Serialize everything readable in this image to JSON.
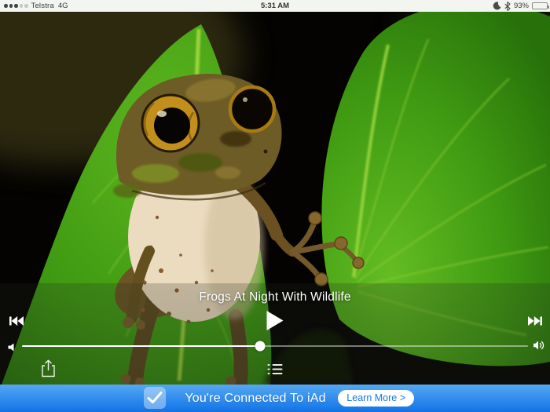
{
  "status_bar": {
    "carrier": "Telstra",
    "network": "4G",
    "time": "5:31 AM",
    "battery_percent": "93%",
    "signal_filled_dots": 3,
    "signal_total_dots": 5,
    "icons": [
      "cell-signal-dots",
      "do-not-disturb-moon",
      "bluetooth",
      "battery"
    ]
  },
  "player": {
    "title": "Frogs At Night With Wildlife",
    "volume_percent": 47,
    "transport_icons": [
      "previous-track",
      "play",
      "next-track"
    ],
    "secondary_icons": [
      "share",
      "playlist"
    ],
    "photo_subject": "frog on green leaves"
  },
  "banner": {
    "message": "You're Connected To iAd",
    "cta_label": "Learn More >",
    "checkbox_icon": "checkmark",
    "colors": {
      "top": "#54a8f3",
      "bottom": "#1273e6",
      "cta_text": "#1777e8"
    }
  },
  "colors": {
    "status_bar_bg": "#f3f5f1",
    "overlay_text": "#ffffff",
    "leaf_green": "#3f9a12",
    "background": "#000000"
  }
}
